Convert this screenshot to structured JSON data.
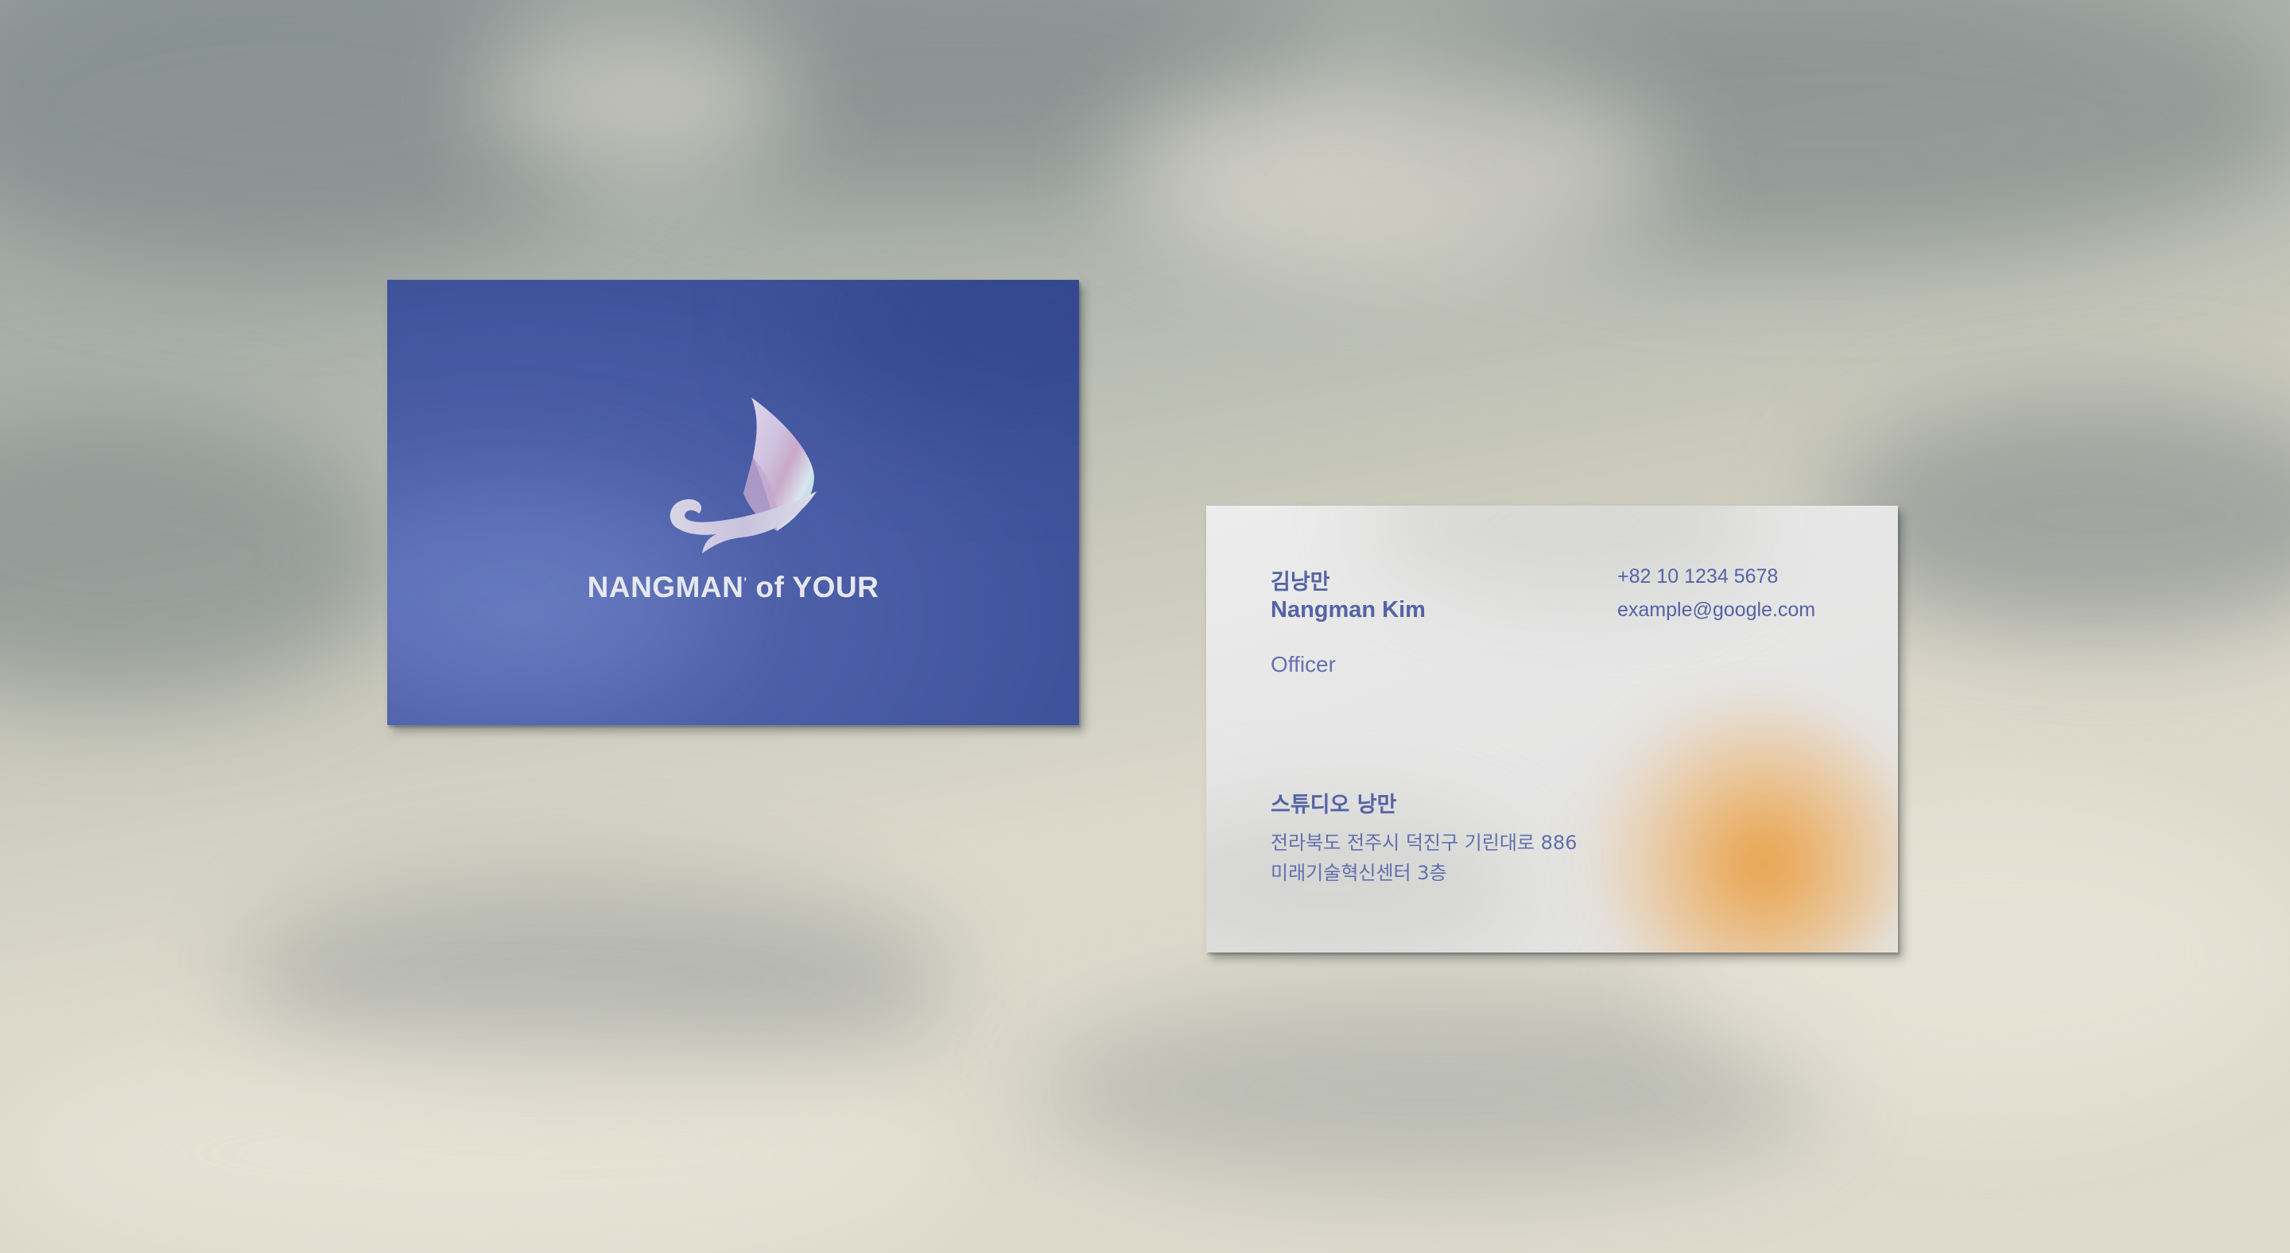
{
  "front_card": {
    "brand": "NANGMAN",
    "brand_mark": "'",
    "brand_suffix": " of YOUR",
    "logo_icon": "sailboat-logo-icon"
  },
  "back_card": {
    "name_korean": "김낭만",
    "name_english": "Nangman Kim",
    "title": "Officer",
    "phone": "+82 10 1234 5678",
    "email": "example@google.com",
    "company": "스튜디오 낭만",
    "address_line1": "전라북도 전주시 덕진구 기린대로 886",
    "address_line2": "미래기술혁신센터 3층"
  },
  "colors": {
    "card_front": "#4357a0",
    "card_back": "#e7e7e6",
    "text_back": "#5563a6",
    "glow": "#e99b3c"
  }
}
